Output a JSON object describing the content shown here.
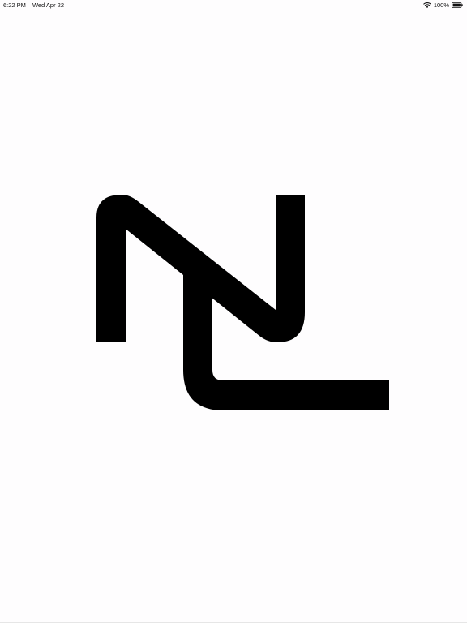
{
  "status_bar": {
    "time": "6:22 PM",
    "date": "Wed Apr 22",
    "battery_percent": "100%",
    "icons": [
      "wifi-icon",
      "battery-icon"
    ]
  },
  "splash": {
    "logo_icon": "nl-monogram-logo",
    "logo_color": "#000000",
    "background_color": "#fefdfe"
  }
}
